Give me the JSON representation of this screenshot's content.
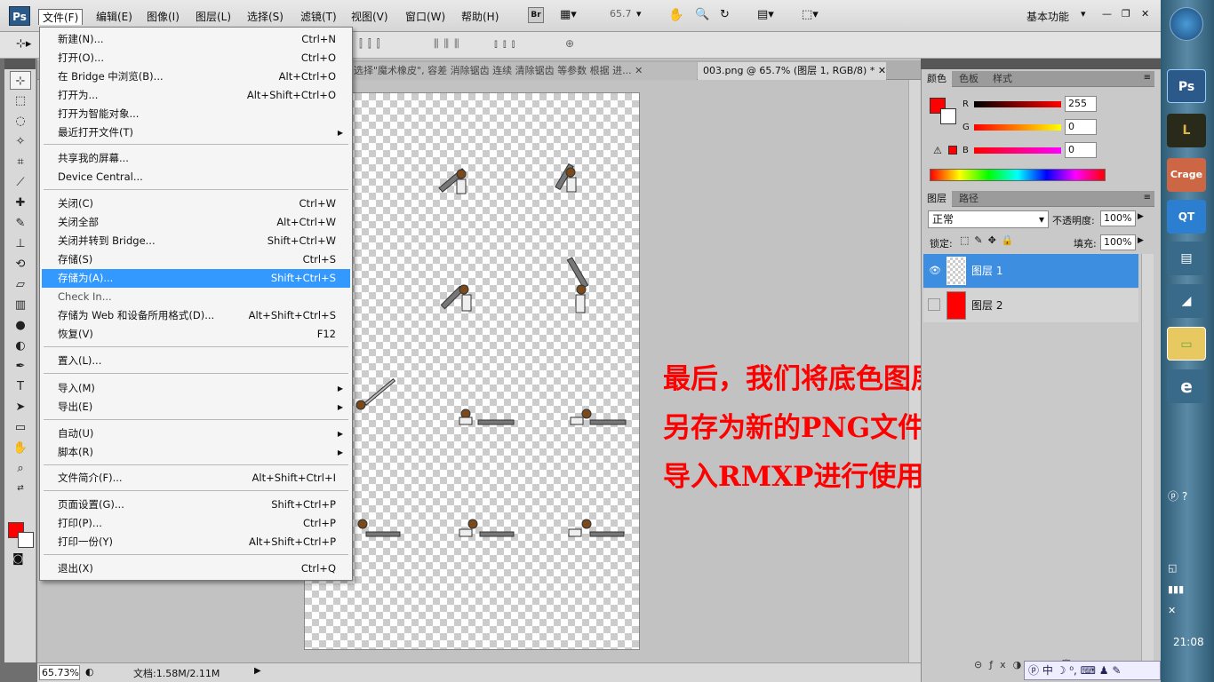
{
  "menubar": {
    "logo": "Ps",
    "menus": [
      "文件(F)",
      "编辑(E)",
      "图像(I)",
      "图层(L)",
      "选择(S)",
      "滤镜(T)",
      "视图(V)",
      "窗口(W)",
      "帮助(H)"
    ],
    "bridge_btn": "Br",
    "zoom": "65.7",
    "workspace": "基本功能"
  },
  "tabs": [
    {
      "label": "选择\"魔术橡皮\", 容差   消除锯齿 连续 清除锯齿 等参数 根据   进..."
    },
    {
      "label": "003.png @ 65.7% (图层 1, RGB/8) *"
    }
  ],
  "file_menu": {
    "items": [
      {
        "label": "新建(N)...",
        "shortcut": "Ctrl+N"
      },
      {
        "label": "打开(O)...",
        "shortcut": "Ctrl+O"
      },
      {
        "label": "在 Bridge 中浏览(B)...",
        "shortcut": "Alt+Ctrl+O"
      },
      {
        "label": "打开为...",
        "shortcut": "Alt+Shift+Ctrl+O"
      },
      {
        "label": "打开为智能对象..."
      },
      {
        "label": "最近打开文件(T)"
      },
      {
        "label": "共享我的屏幕..."
      },
      {
        "label": "Device Central..."
      },
      {
        "label": "关闭(C)",
        "shortcut": "Ctrl+W"
      },
      {
        "label": "关闭全部",
        "shortcut": "Alt+Ctrl+W"
      },
      {
        "label": "关闭并转到 Bridge...",
        "shortcut": "Shift+Ctrl+W"
      },
      {
        "label": "存储(S)",
        "shortcut": "Ctrl+S"
      },
      {
        "label": "存储为(A)...",
        "shortcut": "Shift+Ctrl+S"
      },
      {
        "label": "Check In..."
      },
      {
        "label": "存储为 Web 和设备所用格式(D)...",
        "shortcut": "Alt+Shift+Ctrl+S"
      },
      {
        "label": "恢复(V)",
        "shortcut": "F12"
      },
      {
        "label": "置入(L)..."
      },
      {
        "label": "导入(M)"
      },
      {
        "label": "导出(E)"
      },
      {
        "label": "自动(U)"
      },
      {
        "label": "脚本(R)"
      },
      {
        "label": "文件简介(F)...",
        "shortcut": "Alt+Shift+Ctrl+I"
      },
      {
        "label": "页面设置(G)...",
        "shortcut": "Shift+Ctrl+P"
      },
      {
        "label": "打印(P)...",
        "shortcut": "Ctrl+P"
      },
      {
        "label": "打印一份(Y)",
        "shortcut": "Alt+Shift+Ctrl+P"
      },
      {
        "label": "退出(X)",
        "shortcut": "Ctrl+Q"
      }
    ]
  },
  "annotation": {
    "line1": "最后，我们将底色图层隐藏后",
    "line2": "另存为新的PNG文件，就可以",
    "line3": "导入RMXP进行使用了"
  },
  "status": {
    "zoom": "65.73%",
    "doc": "文档:1.58M/2.11M"
  },
  "color_panel": {
    "tabs": [
      "颜色",
      "色板",
      "样式"
    ],
    "r_label": "R",
    "g_label": "G",
    "b_label": "B",
    "r": "255",
    "g": "0",
    "b": "0",
    "foreground": "#ff0000"
  },
  "layers_panel": {
    "tabs": [
      "图层",
      "路径"
    ],
    "blend_mode": "正常",
    "opacity_label": "不透明度:",
    "opacity": "100%",
    "lock_label": "锁定:",
    "fill_label": "填充:",
    "fill": "100%",
    "layers": [
      {
        "name": "图层 1",
        "visible": true,
        "selected": true
      },
      {
        "name": "图层 2",
        "visible": false,
        "selected": false,
        "color": "#ff0000"
      }
    ]
  },
  "taskbar": {
    "clock": "21:08",
    "apps": [
      "Ps",
      "L",
      "Crage",
      "QT",
      "e"
    ],
    "ime": "中"
  }
}
